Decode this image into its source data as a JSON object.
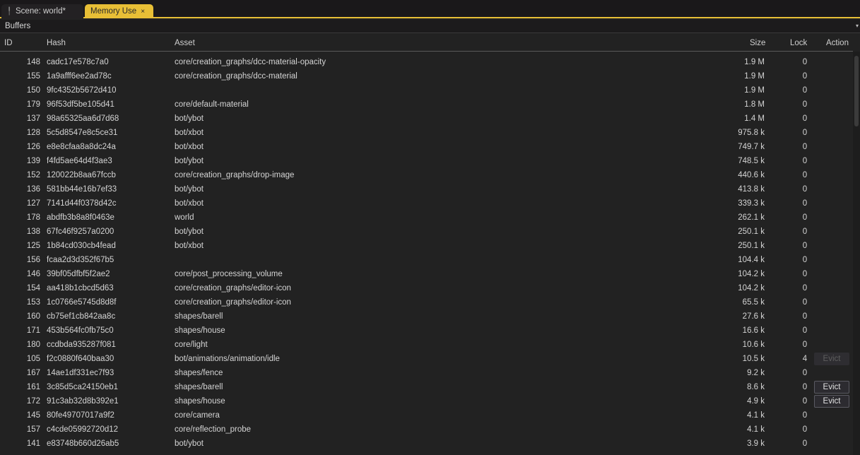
{
  "tabs": [
    {
      "label": "Scene: world*",
      "icon": "pin-icon",
      "active": false
    },
    {
      "label": "Memory Use",
      "icon": "close-icon",
      "active": true,
      "close_glyph": "×"
    }
  ],
  "combo": {
    "selected": "Buffers",
    "arrow": "▾"
  },
  "columns": {
    "id": "ID",
    "hash": "Hash",
    "asset": "Asset",
    "size": "Size",
    "lock": "Lock",
    "action": "Action"
  },
  "colors": {
    "accent": "#e8bf36",
    "background": "#222222"
  },
  "rows": [
    {
      "id": "148",
      "hash": "cadc17e578c7a0",
      "asset": "core/creation_graphs/dcc-material-opacity",
      "size": "1.9 M",
      "lock": "0",
      "action": ""
    },
    {
      "id": "155",
      "hash": "1a9afff6ee2ad78c",
      "asset": "core/creation_graphs/dcc-material",
      "size": "1.9 M",
      "lock": "0",
      "action": ""
    },
    {
      "id": "150",
      "hash": "9fc4352b5672d410",
      "asset": "",
      "size": "1.9 M",
      "lock": "0",
      "action": ""
    },
    {
      "id": "179",
      "hash": "96f53df5be105d41",
      "asset": "core/default-material",
      "size": "1.8 M",
      "lock": "0",
      "action": ""
    },
    {
      "id": "137",
      "hash": "98a65325aa6d7d68",
      "asset": "bot/ybot",
      "size": "1.4 M",
      "lock": "0",
      "action": ""
    },
    {
      "id": "128",
      "hash": "5c5d8547e8c5ce31",
      "asset": "bot/xbot",
      "size": "975.8 k",
      "lock": "0",
      "action": ""
    },
    {
      "id": "126",
      "hash": "e8e8cfaa8a8dc24a",
      "asset": "bot/xbot",
      "size": "749.7 k",
      "lock": "0",
      "action": ""
    },
    {
      "id": "139",
      "hash": "f4fd5ae64d4f3ae3",
      "asset": "bot/ybot",
      "size": "748.5 k",
      "lock": "0",
      "action": ""
    },
    {
      "id": "152",
      "hash": "120022b8aa67fccb",
      "asset": "core/creation_graphs/drop-image",
      "size": "440.6 k",
      "lock": "0",
      "action": ""
    },
    {
      "id": "136",
      "hash": "581bb44e16b7ef33",
      "asset": "bot/ybot",
      "size": "413.8 k",
      "lock": "0",
      "action": ""
    },
    {
      "id": "127",
      "hash": "7141d44f0378d42c",
      "asset": "bot/xbot",
      "size": "339.3 k",
      "lock": "0",
      "action": ""
    },
    {
      "id": "178",
      "hash": "abdfb3b8a8f0463e",
      "asset": "world",
      "size": "262.1 k",
      "lock": "0",
      "action": ""
    },
    {
      "id": "138",
      "hash": "67fc46f9257a0200",
      "asset": "bot/ybot",
      "size": "250.1 k",
      "lock": "0",
      "action": ""
    },
    {
      "id": "125",
      "hash": "1b84cd030cb4fead",
      "asset": "bot/xbot",
      "size": "250.1 k",
      "lock": "0",
      "action": ""
    },
    {
      "id": "156",
      "hash": "fcaa2d3d352f67b5",
      "asset": "",
      "size": "104.4 k",
      "lock": "0",
      "action": ""
    },
    {
      "id": "146",
      "hash": "39bf05dfbf5f2ae2",
      "asset": "core/post_processing_volume",
      "size": "104.2 k",
      "lock": "0",
      "action": ""
    },
    {
      "id": "154",
      "hash": "aa418b1cbcd5d63",
      "asset": "core/creation_graphs/editor-icon",
      "size": "104.2 k",
      "lock": "0",
      "action": ""
    },
    {
      "id": "153",
      "hash": "1c0766e5745d8d8f",
      "asset": "core/creation_graphs/editor-icon",
      "size": "65.5 k",
      "lock": "0",
      "action": ""
    },
    {
      "id": "160",
      "hash": "cb75ef1cb842aa8c",
      "asset": "shapes/barell",
      "size": "27.6 k",
      "lock": "0",
      "action": ""
    },
    {
      "id": "171",
      "hash": "453b564fc0fb75c0",
      "asset": "shapes/house",
      "size": "16.6 k",
      "lock": "0",
      "action": ""
    },
    {
      "id": "180",
      "hash": "ccdbda935287f081",
      "asset": "core/light",
      "size": "10.6 k",
      "lock": "0",
      "action": ""
    },
    {
      "id": "105",
      "hash": "f2c0880f640baa30",
      "asset": "bot/animations/animation/idle",
      "size": "10.5 k",
      "lock": "4",
      "action": "Evict",
      "action_disabled": true
    },
    {
      "id": "167",
      "hash": "14ae1df331ec7f93",
      "asset": "shapes/fence",
      "size": "9.2 k",
      "lock": "0",
      "action": ""
    },
    {
      "id": "161",
      "hash": "3c85d5ca24150eb1",
      "asset": "shapes/barell",
      "size": "8.6 k",
      "lock": "0",
      "action": "Evict",
      "action_disabled": false
    },
    {
      "id": "172",
      "hash": "91c3ab32d8b392e1",
      "asset": "shapes/house",
      "size": "4.9 k",
      "lock": "0",
      "action": "Evict",
      "action_disabled": false
    },
    {
      "id": "145",
      "hash": "80fe49707017a9f2",
      "asset": "core/camera",
      "size": "4.1 k",
      "lock": "0",
      "action": ""
    },
    {
      "id": "157",
      "hash": "c4cde05992720d12",
      "asset": "core/reflection_probe",
      "size": "4.1 k",
      "lock": "0",
      "action": ""
    },
    {
      "id": "141",
      "hash": "e83748b660d26ab5",
      "asset": "bot/ybot",
      "size": "3.9 k",
      "lock": "0",
      "action": ""
    }
  ]
}
